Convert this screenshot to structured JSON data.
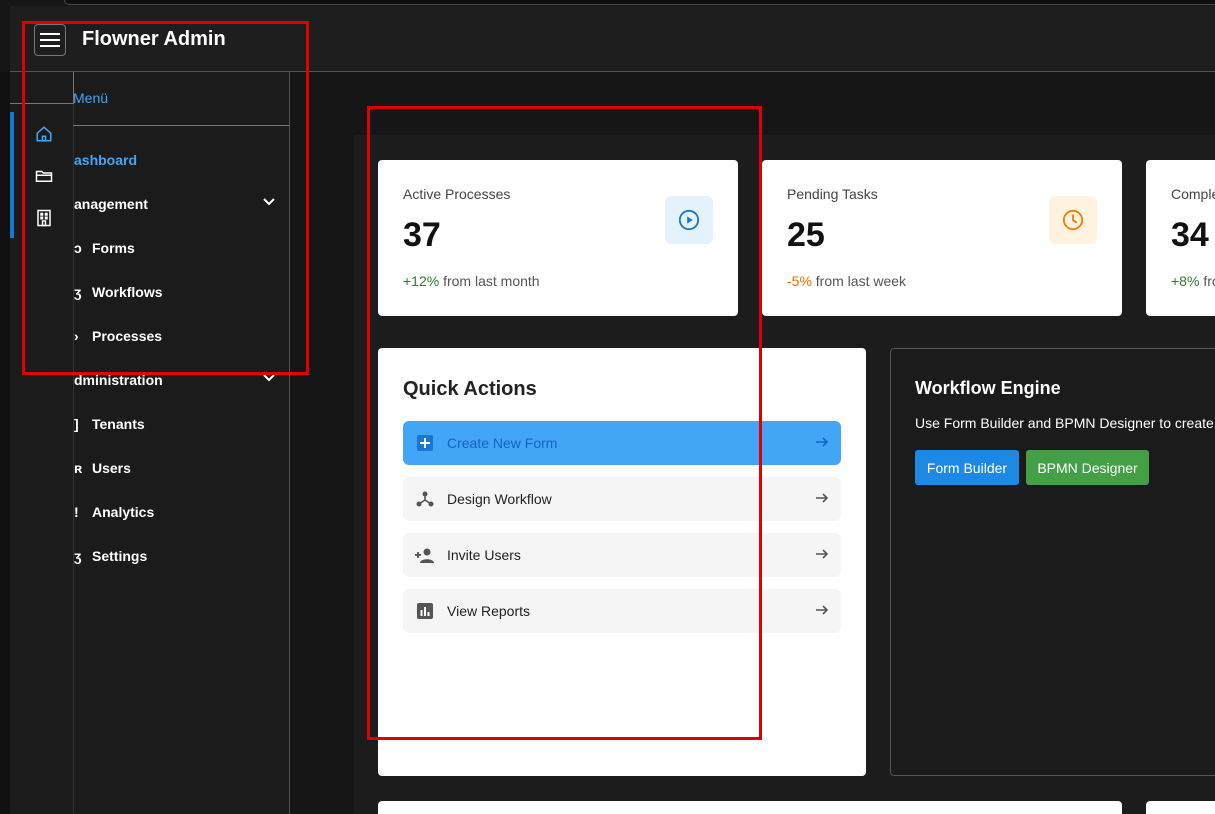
{
  "app": {
    "title": "Flowner Admin"
  },
  "sidebar": {
    "menu_header": "Menü",
    "items": [
      {
        "label": "ashboard",
        "active": true
      },
      {
        "label": "anagement",
        "expandable": true
      },
      {
        "label": "Forms",
        "prefix": "ɔ"
      },
      {
        "label": "Workflows",
        "prefix": "ʒ"
      },
      {
        "label": "Processes",
        "prefix": "›"
      },
      {
        "label": "dministration",
        "expandable": true
      },
      {
        "label": "Tenants",
        "prefix": "]"
      },
      {
        "label": "Users",
        "prefix": "ʀ"
      },
      {
        "label": "Analytics",
        "prefix": "!"
      },
      {
        "label": "Settings",
        "prefix": "ʒ"
      }
    ],
    "rail_icons": [
      "home-icon",
      "folder-icon",
      "building-icon"
    ]
  },
  "stats": [
    {
      "label": "Active Processes",
      "value": "37",
      "trend": "+12%",
      "trend_text": "from last month",
      "trend_color": "#2e7d32",
      "icon": "play-circle-icon",
      "icon_color": "#1976d2",
      "icon_bg": "#e3f2fd"
    },
    {
      "label": "Pending Tasks",
      "value": "25",
      "trend": "-5%",
      "trend_text": "from last week",
      "trend_color": "#ef6c00",
      "icon": "clock-icon",
      "icon_color": "#f57c00",
      "icon_bg": "#fff3e0"
    },
    {
      "label": "Comple",
      "value": "34",
      "trend": "+8%",
      "trend_text": "fro",
      "trend_color": "#2e7d32"
    }
  ],
  "quick_actions": {
    "title": "Quick Actions",
    "items": [
      {
        "label": "Create New Form",
        "icon": "add-box-icon"
      },
      {
        "label": "Design Workflow",
        "icon": "workflow-icon"
      },
      {
        "label": "Invite Users",
        "icon": "person-add-icon"
      },
      {
        "label": "View Reports",
        "icon": "chart-icon"
      }
    ]
  },
  "workflow_engine": {
    "title": "Workflow Engine",
    "description": "Use Form Builder and BPMN Designer to create c",
    "form_builder_label": "Form Builder",
    "bpmn_designer_label": "BPMN Designer"
  },
  "colors": {
    "accent": "#42a5f5",
    "primary": "#1e88e5",
    "success": "#43a047",
    "highlight": "#e00000"
  }
}
